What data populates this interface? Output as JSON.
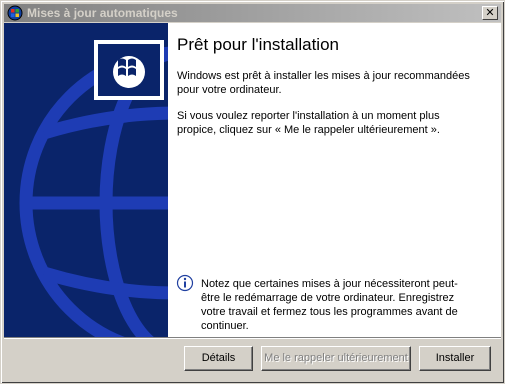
{
  "window": {
    "title": "Mises à jour automatiques",
    "close_glyph": "✕"
  },
  "main": {
    "heading": "Prêt pour l'installation",
    "paragraph1": "Windows est prêt à installer les mises à jour recommandées pour votre ordinateur.",
    "paragraph2": "Si vous voulez reporter l'installation à un moment plus propice, cliquez sur « Me le rappeler ultérieurement ».",
    "note": "Notez que certaines mises à jour nécessiteront peut-être le redémarrage de votre ordinateur. Enregistrez votre travail et fermez tous les programmes avant de continuer."
  },
  "buttons": {
    "details": "Détails",
    "remind_later": "Me le rappeler ultérieurement",
    "install": "Installer"
  },
  "icons": {
    "title": "windows-update-icon",
    "logo": "windows-logo-icon",
    "note": "info-icon",
    "globe": "globe-graphic"
  },
  "colors": {
    "side_panel": "#0a246a",
    "globe_lines": "#1e3cb4",
    "dialog_face": "#d4d0c8"
  }
}
